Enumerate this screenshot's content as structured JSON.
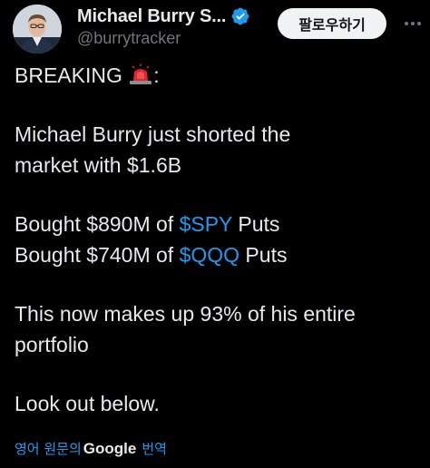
{
  "post": {
    "author": {
      "display_name": "Michael Burry S...",
      "handle": "@burrytracker",
      "verified": true,
      "avatar_icon": "profile-photo"
    },
    "follow_label": "팔로우하기",
    "text": {
      "breaking": "BREAKING",
      "breaking_suffix": ":",
      "breaking_emoji": "police-siren-icon",
      "line1": "Michael Burry just shorted the",
      "line2": "market with $1.6B",
      "spy_prefix": "Bought $890M of ",
      "spy_tag": "$SPY",
      "spy_suffix": " Puts",
      "qqq_prefix": "Bought $740M of ",
      "qqq_tag": "$QQQ",
      "qqq_suffix": " Puts",
      "line5": "This now makes up 93% of his entire",
      "line6": "portfolio",
      "line7": "Look out below."
    },
    "translate": {
      "prefix": "영어 원문의",
      "brand": "Google",
      "suffix": "번역"
    }
  },
  "colors": {
    "background": "#000000",
    "text": "#e7e9ea",
    "muted": "#71767b",
    "link": "#1d9bf0",
    "button_bg": "#eff3f4"
  }
}
